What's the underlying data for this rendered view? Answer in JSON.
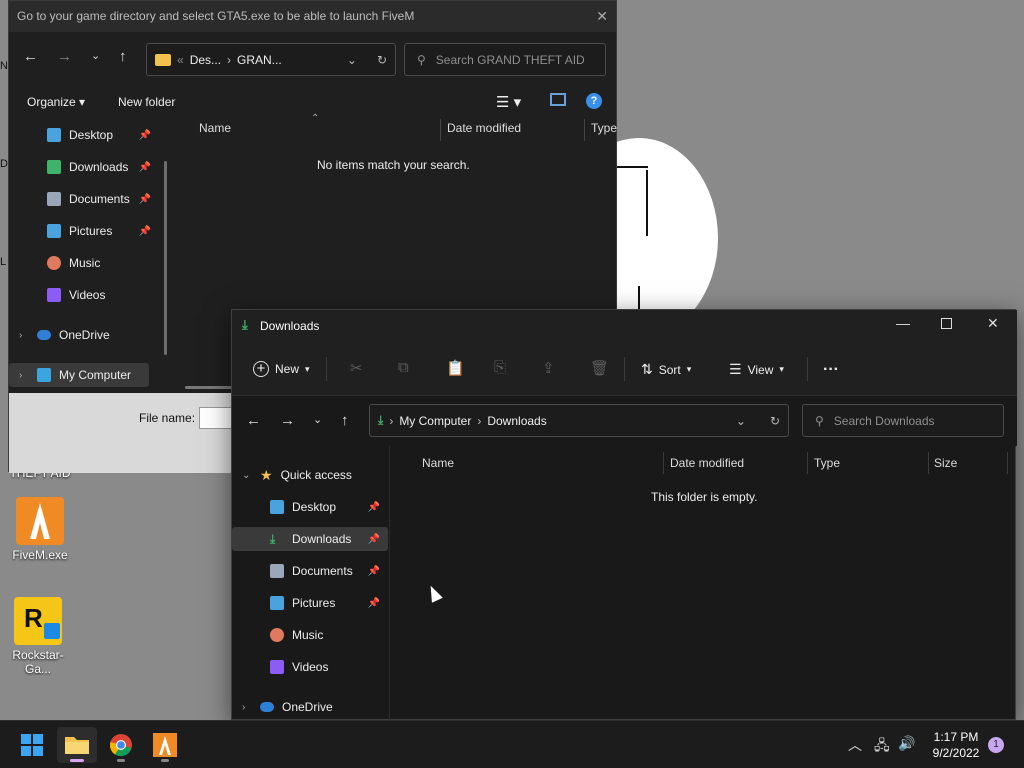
{
  "desktop": {
    "edge_letters": [
      "N",
      "D",
      "L"
    ],
    "behind_label": "THEFT AID",
    "icons": [
      {
        "label": "FiveM.exe"
      },
      {
        "label": "Rockstar-Ga..."
      }
    ]
  },
  "dialog": {
    "title": "Go to your game directory and select GTA5.exe to be able to launch FiveM",
    "address": {
      "overflow": "«",
      "crumbs": [
        "Des...",
        "GRAN..."
      ]
    },
    "search_placeholder": "Search GRAND THEFT AID",
    "toolbar": {
      "organize": "Organize",
      "new_folder": "New folder",
      "help": "?"
    },
    "sidebar": [
      {
        "label": "Desktop",
        "pinned": true,
        "color": "#4aa3df"
      },
      {
        "label": "Downloads",
        "pinned": true,
        "color": "#3fb36a"
      },
      {
        "label": "Documents",
        "pinned": true,
        "color": "#9aa7b8"
      },
      {
        "label": "Pictures",
        "pinned": true,
        "color": "#4aa3df"
      },
      {
        "label": "Music",
        "pinned": false,
        "color": "#e07a5f"
      },
      {
        "label": "Videos",
        "pinned": false,
        "color": "#8b5cf6"
      },
      {
        "label": "OneDrive",
        "pinned": false,
        "color": "#2f7fd6"
      },
      {
        "label": "My Computer",
        "pinned": false,
        "color": "#3ba5e0"
      }
    ],
    "columns": [
      "Name",
      "Date modified",
      "Type"
    ],
    "empty_message": "No items match your search.",
    "file_name_label": "File name:"
  },
  "explorer": {
    "title": "Downloads",
    "commands": {
      "new": "New",
      "sort": "Sort",
      "view": "View",
      "more": "···"
    },
    "address": {
      "crumbs": [
        "My Computer",
        "Downloads"
      ]
    },
    "search_placeholder": "Search Downloads",
    "sidebar": [
      {
        "label": "Quick access",
        "color": "#f2c14e"
      },
      {
        "label": "Desktop",
        "pinned": true,
        "color": "#4aa3df"
      },
      {
        "label": "Downloads",
        "pinned": true,
        "color": "#3fb36a"
      },
      {
        "label": "Documents",
        "pinned": true,
        "color": "#9aa7b8"
      },
      {
        "label": "Pictures",
        "pinned": true,
        "color": "#4aa3df"
      },
      {
        "label": "Music",
        "pinned": false,
        "color": "#e07a5f"
      },
      {
        "label": "Videos",
        "pinned": false,
        "color": "#8b5cf6"
      },
      {
        "label": "OneDrive",
        "pinned": false,
        "color": "#2f7fd6"
      }
    ],
    "columns": [
      "Name",
      "Date modified",
      "Type",
      "Size"
    ],
    "empty_message": "This folder is empty."
  },
  "taskbar": {
    "time": "1:17 PM",
    "date": "9/2/2022",
    "notification_count": "1"
  },
  "colors": {
    "accent": "#3b8eea",
    "folder": "#f2c14e",
    "fivem": "#f08a24"
  }
}
